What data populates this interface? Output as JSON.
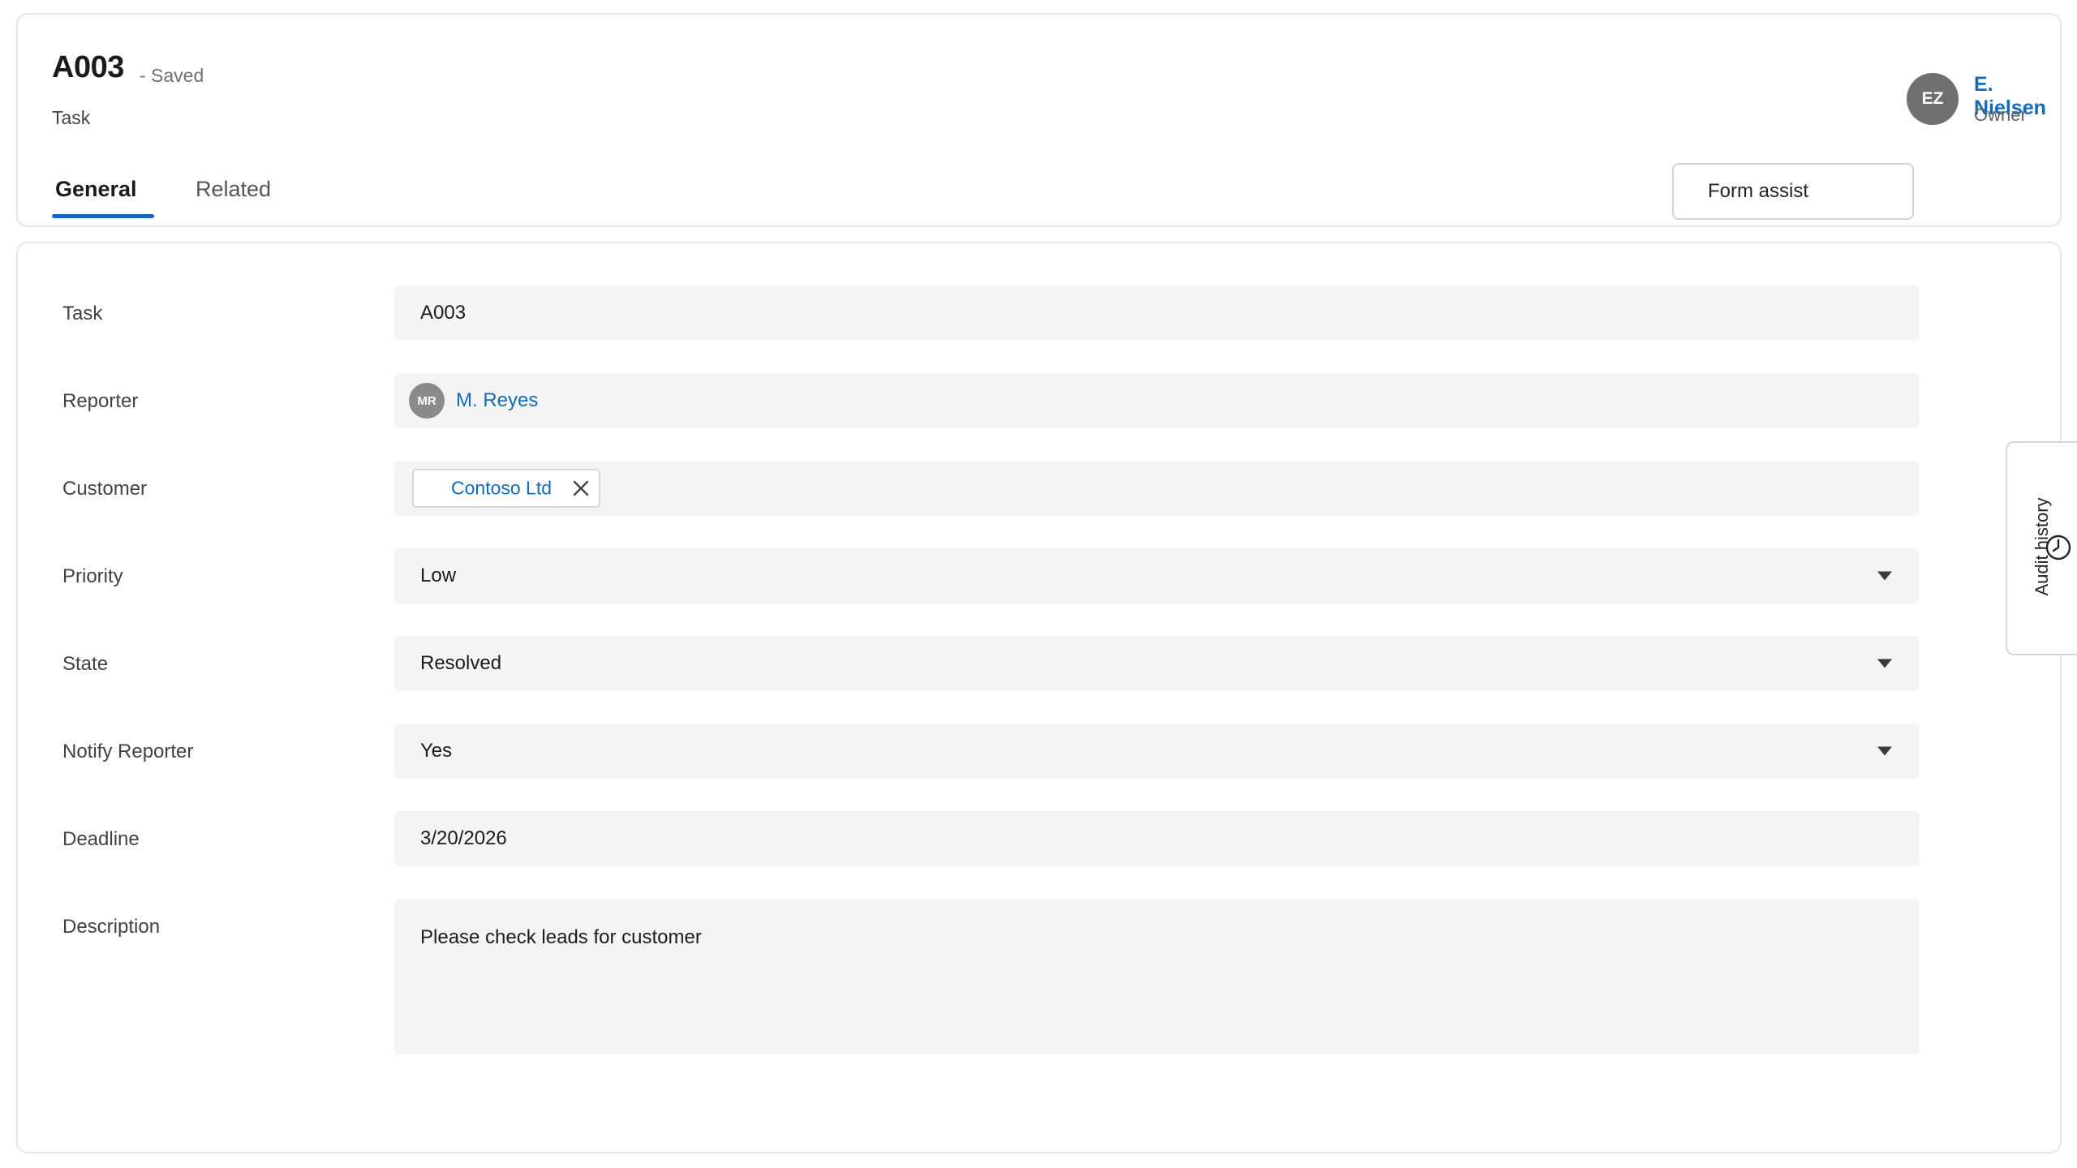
{
  "header": {
    "record_title": "A003",
    "save_status": "- Saved",
    "entity_type": "Task",
    "tabs": [
      {
        "label": "General",
        "active": true
      },
      {
        "label": "Related",
        "active": false
      }
    ],
    "form_assist_label": "Form assist",
    "owner": {
      "initials": "EZ",
      "name": "E. Nielsen",
      "role": "Owner"
    }
  },
  "form": {
    "fields": [
      {
        "label": "Task",
        "value": "A003"
      },
      {
        "label": "Reporter",
        "value": "M. Reyes",
        "initials": "MR"
      },
      {
        "label": "Customer",
        "value": "Contoso Ltd"
      },
      {
        "label": "Priority",
        "value": "Low"
      },
      {
        "label": "State",
        "value": "Resolved"
      },
      {
        "label": "Notify Reporter",
        "value": "Yes"
      },
      {
        "label": "Deadline",
        "value": "3/20/2026"
      },
      {
        "label": "Description",
        "value": "Please check leads for customer"
      }
    ]
  },
  "side_panel": {
    "audit_history_label": "Audit history"
  },
  "colors": {
    "accent": "#0f6cbd",
    "tab_indicator": "#1565c0",
    "field_background": "#f4f4f4",
    "avatar_background": "#707070"
  }
}
